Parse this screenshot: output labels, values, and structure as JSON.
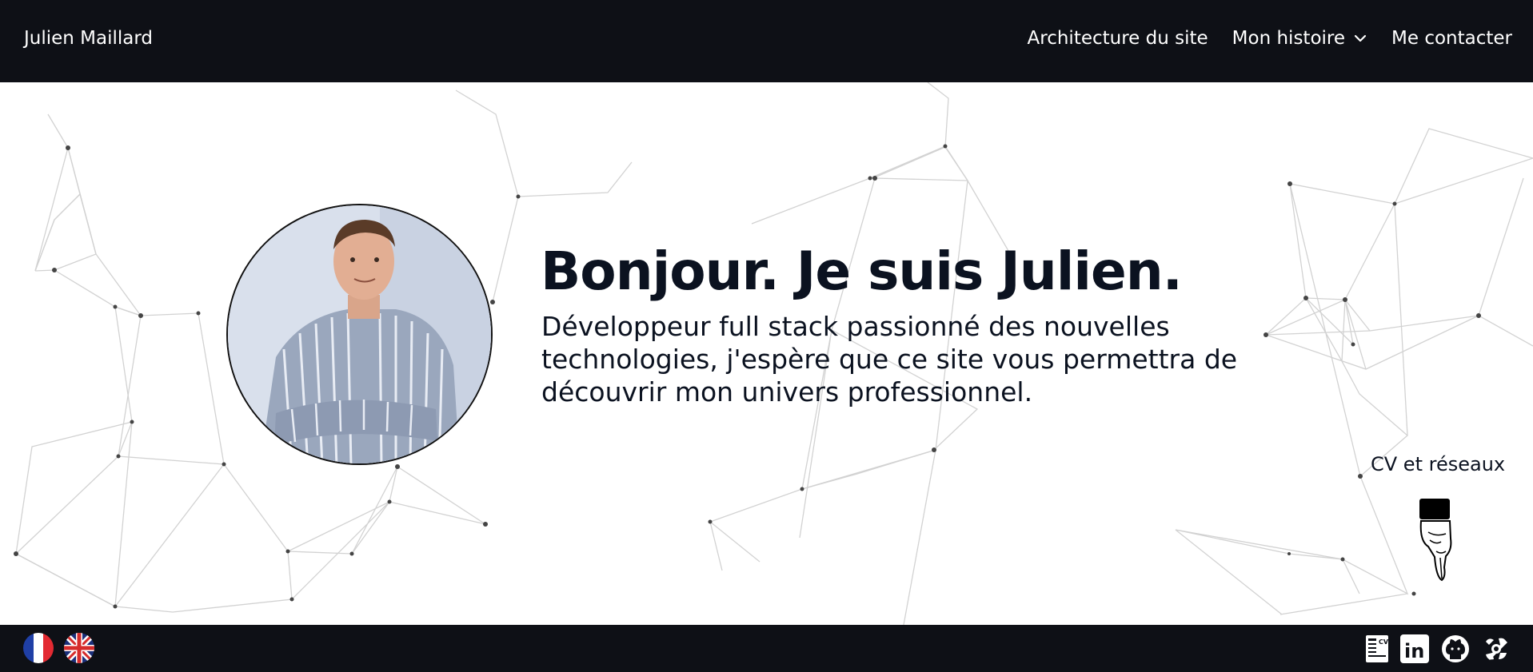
{
  "header": {
    "brand": "Julien Maillard",
    "nav": [
      {
        "label": "Architecture du site"
      },
      {
        "label": "Mon histoire",
        "has_dropdown": true
      },
      {
        "label": "Me contacter"
      }
    ]
  },
  "hero": {
    "title": "Bonjour. Je suis Julien.",
    "intro": "Développeur full stack passionné des nouvelles technologies, j'espère que ce site vous permettra de découvrir mon univers professionnel.",
    "cv_label": "CV et réseaux"
  },
  "footer": {
    "languages": [
      {
        "icon": "french-flag-icon"
      },
      {
        "icon": "uk-flag-icon"
      }
    ],
    "social": [
      {
        "icon": "cv-icon",
        "label": "CV"
      },
      {
        "icon": "linkedin-icon",
        "label": "in"
      },
      {
        "icon": "github-icon"
      },
      {
        "icon": "badge-icon"
      }
    ]
  },
  "colors": {
    "bar": "#0e1016",
    "text_dark": "#0b1220",
    "network_line": "#cfcfcf",
    "network_node": "#444444"
  }
}
